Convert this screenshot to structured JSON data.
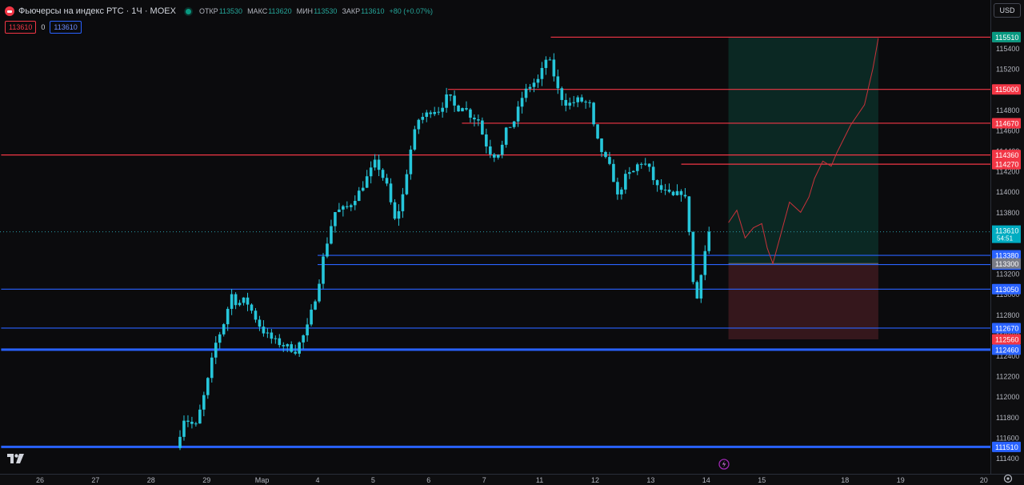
{
  "header": {
    "title": "Фьючерсы на индекс РТС · 1Ч · MOEX",
    "open_label": "ОТКР",
    "open_value": "113530",
    "high_label": "МАКС",
    "high_value": "113620",
    "low_label": "МИН",
    "low_value": "113530",
    "close_label": "ЗАКР",
    "close_value": "113610",
    "change": "+80 (+0.07%)"
  },
  "quote": {
    "sell": "113610",
    "spread": "0",
    "buy": "113610"
  },
  "currency": "USD",
  "colors": {
    "background": "#0e0e10",
    "candle": "#26c6da",
    "resistance": "#f23645",
    "support": "#2962ff",
    "profit_zone": "#0b2b26",
    "loss_zone": "#3a181e"
  },
  "chart_data": {
    "type": "candlestick",
    "timeframe": "1H",
    "ylim": [
      111400,
      115700
    ],
    "y_ticks": [
      "115400",
      "115200",
      "115000",
      "114800",
      "114600",
      "114400",
      "114200",
      "114000",
      "113800",
      "113600",
      "113400",
      "113200",
      "113000",
      "112800",
      "112600",
      "112400",
      "112200",
      "112000",
      "111800",
      "111600",
      "111400"
    ],
    "x_ticks": [
      {
        "label": "26",
        "day": 0
      },
      {
        "label": "27",
        "day": 1
      },
      {
        "label": "28",
        "day": 2
      },
      {
        "label": "29",
        "day": 3
      },
      {
        "label": "Мар",
        "day": 4
      },
      {
        "label": "4",
        "day": 5
      },
      {
        "label": "5",
        "day": 6
      },
      {
        "label": "6",
        "day": 7
      },
      {
        "label": "7",
        "day": 8
      },
      {
        "label": "11",
        "day": 9
      },
      {
        "label": "12",
        "day": 10
      },
      {
        "label": "13",
        "day": 11
      },
      {
        "label": "14",
        "day": 12
      },
      {
        "label": "15",
        "day": 13
      },
      {
        "label": "18",
        "day": 14.5
      },
      {
        "label": "19",
        "day": 15.5
      },
      {
        "label": "20",
        "day": 17
      }
    ],
    "close_path": [
      [
        2.45,
        111500
      ],
      [
        2.6,
        111800
      ],
      [
        2.8,
        111700
      ],
      [
        3.0,
        112100
      ],
      [
        3.15,
        112500
      ],
      [
        3.3,
        112700
      ],
      [
        3.45,
        113000
      ],
      [
        3.55,
        112900
      ],
      [
        3.7,
        112950
      ],
      [
        3.85,
        112800
      ],
      [
        4.0,
        112650
      ],
      [
        4.2,
        112550
      ],
      [
        4.4,
        112500
      ],
      [
        4.6,
        112450
      ],
      [
        4.8,
        112650
      ],
      [
        5.0,
        113050
      ],
      [
        5.1,
        113350
      ],
      [
        5.3,
        113800
      ],
      [
        5.55,
        113850
      ],
      [
        5.75,
        114000
      ],
      [
        5.9,
        114150
      ],
      [
        6.05,
        114300
      ],
      [
        6.25,
        114050
      ],
      [
        6.4,
        113700
      ],
      [
        6.55,
        114000
      ],
      [
        6.65,
        114350
      ],
      [
        6.8,
        114700
      ],
      [
        6.95,
        114750
      ],
      [
        7.05,
        114800
      ],
      [
        7.2,
        114800
      ],
      [
        7.35,
        114950
      ],
      [
        7.5,
        114800
      ],
      [
        7.6,
        114850
      ],
      [
        7.75,
        114750
      ],
      [
        7.9,
        114700
      ],
      [
        8.0,
        114500
      ],
      [
        8.15,
        114350
      ],
      [
        8.3,
        114400
      ],
      [
        8.4,
        114600
      ],
      [
        8.55,
        114700
      ],
      [
        8.7,
        114950
      ],
      [
        8.85,
        115050
      ],
      [
        9.0,
        115100
      ],
      [
        9.1,
        115300
      ],
      [
        9.2,
        115250
      ],
      [
        9.35,
        114950
      ],
      [
        9.5,
        114850
      ],
      [
        9.7,
        114900
      ],
      [
        9.9,
        114850
      ],
      [
        10.0,
        114550
      ],
      [
        10.15,
        114350
      ],
      [
        10.3,
        114200
      ],
      [
        10.4,
        113950
      ],
      [
        10.55,
        114150
      ],
      [
        10.7,
        114200
      ],
      [
        10.8,
        114300
      ],
      [
        10.95,
        114250
      ],
      [
        11.1,
        114050
      ],
      [
        11.25,
        114000
      ],
      [
        11.4,
        113950
      ],
      [
        11.55,
        114000
      ],
      [
        11.65,
        113900
      ],
      [
        11.75,
        113250
      ],
      [
        11.8,
        112750
      ],
      [
        11.85,
        113050
      ],
      [
        11.95,
        113350
      ],
      [
        12.05,
        113610
      ]
    ],
    "horizontal_levels": [
      {
        "label": "115510",
        "value": 115510,
        "color": "#f23645",
        "from_day": 9.2
      },
      {
        "label": "115000",
        "value": 115000,
        "color": "#f23645",
        "from_day": 7.35
      },
      {
        "label": "114670",
        "value": 114670,
        "color": "#f23645",
        "from_day": 7.6
      },
      {
        "label": "114360",
        "value": 114360,
        "color": "#f23645",
        "from_day": -0.7
      },
      {
        "label": "114270",
        "value": 114270,
        "color": "#f23645",
        "from_day": 11.55
      },
      {
        "label": "113380",
        "value": 113380,
        "color": "#2962ff",
        "from_day": 5.0
      },
      {
        "label": "113290",
        "value": 113290,
        "color": "#2962ff",
        "from_day": 5.0
      },
      {
        "label": "113050",
        "value": 113050,
        "color": "#2962ff",
        "from_day": -0.7
      },
      {
        "label": "112670",
        "value": 112670,
        "color": "#2962ff",
        "from_day": -0.7
      },
      {
        "label": "112460",
        "value": 112460,
        "color": "#2962ff",
        "from_day": -0.7,
        "thick": true
      },
      {
        "label": "111510",
        "value": 111510,
        "color": "#2962ff",
        "from_day": -0.7,
        "thick": true
      }
    ],
    "position": {
      "entry": 113300,
      "target": 115510,
      "stop": 112560,
      "entry_label": "113300",
      "target_label": "115510",
      "stop_label": "112560",
      "from_day": 12.4,
      "to_day": 15.1
    },
    "projection_path": [
      [
        12.4,
        113700
      ],
      [
        12.55,
        113820
      ],
      [
        12.7,
        113550
      ],
      [
        12.85,
        113650
      ],
      [
        13.0,
        113690
      ],
      [
        13.1,
        113450
      ],
      [
        13.2,
        113300
      ],
      [
        13.35,
        113600
      ],
      [
        13.5,
        113900
      ],
      [
        13.7,
        113800
      ],
      [
        13.85,
        113950
      ],
      [
        13.95,
        114130
      ],
      [
        14.1,
        114300
      ],
      [
        14.25,
        114250
      ],
      [
        14.35,
        114380
      ],
      [
        14.6,
        114650
      ],
      [
        14.85,
        114850
      ],
      [
        15.0,
        115200
      ],
      [
        15.05,
        115350
      ],
      [
        15.1,
        115500
      ]
    ],
    "last_price": {
      "value": "113610",
      "countdown": "54:51"
    }
  }
}
